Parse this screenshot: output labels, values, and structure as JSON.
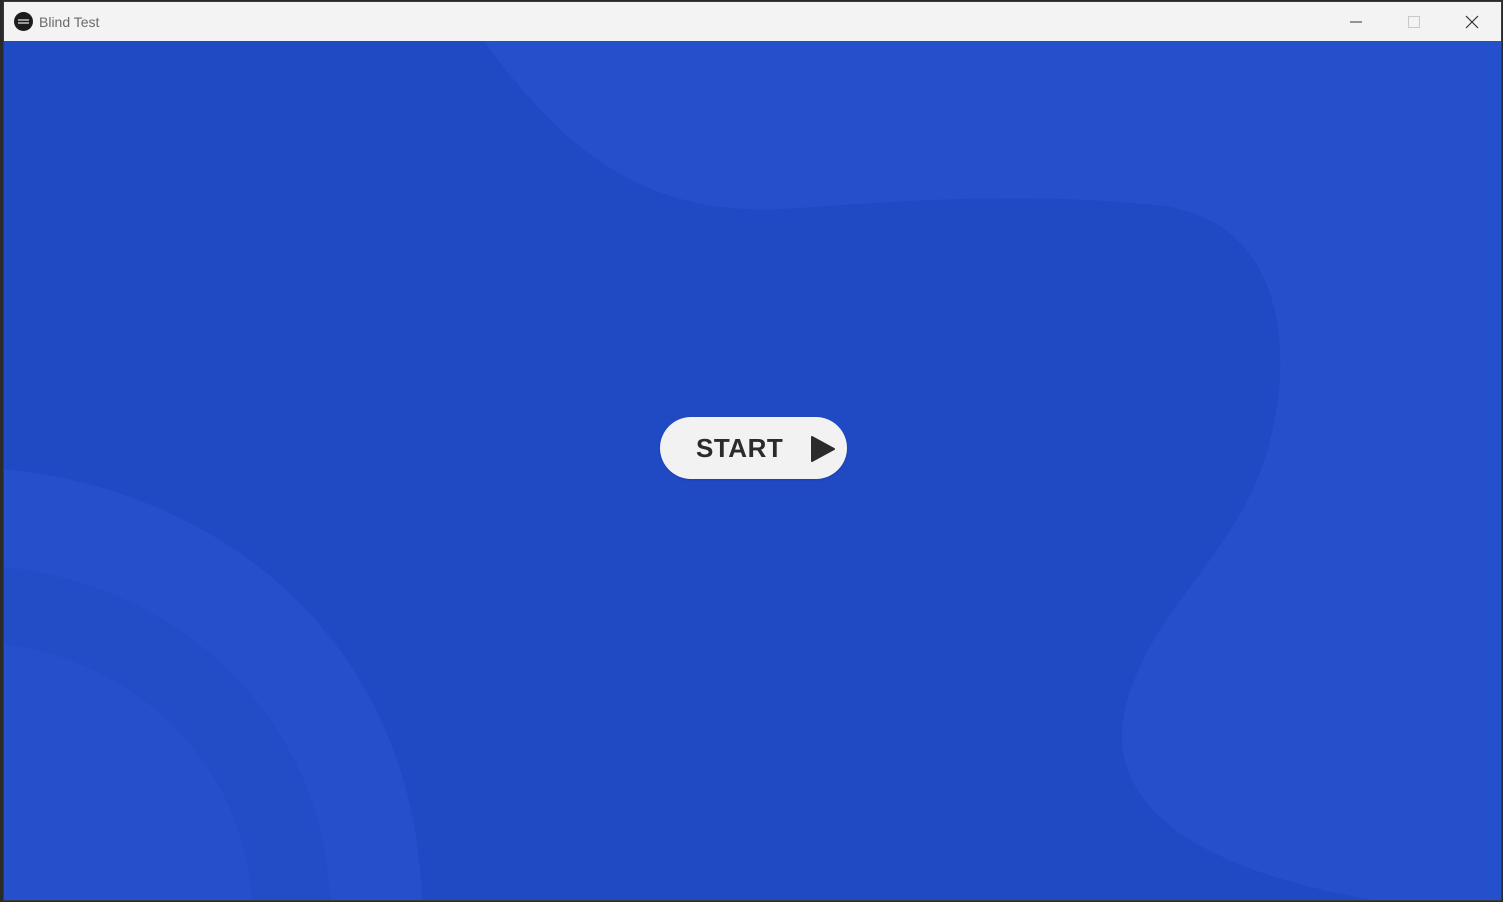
{
  "window": {
    "title": "Blind Test",
    "app_icon": "record-icon",
    "controls": {
      "minimize_icon": "minimize-icon",
      "maximize_icon": "maximize-icon",
      "close_icon": "close-icon"
    }
  },
  "main": {
    "start_button": {
      "label": "START",
      "icon": "play-icon"
    }
  },
  "colors": {
    "background": "#2049c4",
    "background_shape": "#2450cb",
    "button_background": "#f2f2f2",
    "button_text": "#2b2b2b",
    "titlebar": "#f3f3f3"
  }
}
